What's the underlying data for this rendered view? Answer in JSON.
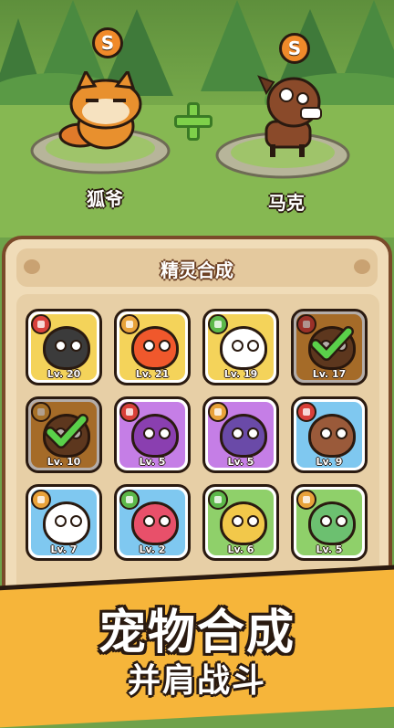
{
  "merge": {
    "left_pet": {
      "name": "狐爷",
      "coin_symbol": "S",
      "icon": "fox-pet-icon"
    },
    "right_pet": {
      "name": "马克",
      "coin_symbol": "S",
      "icon": "horse-pet-icon"
    },
    "plus_icon": "plus-icon"
  },
  "panel": {
    "title": "精灵合成"
  },
  "pets": [
    {
      "level": "Lv. 20",
      "element": "fire",
      "bg": "#f4d35a",
      "body": "#3b3b3b",
      "selected": false
    },
    {
      "level": "Lv. 21",
      "element": "shield",
      "bg": "#f4d35a",
      "body": "#f0582c",
      "selected": false
    },
    {
      "level": "Lv. 19",
      "element": "leaf",
      "bg": "#f4d35a",
      "body": "#ffffff",
      "selected": false
    },
    {
      "level": "Lv. 17",
      "element": "fire",
      "bg": "#e89a3a",
      "body": "#7a4a2a",
      "selected": true
    },
    {
      "level": "Lv. 10",
      "element": "shield",
      "bg": "#e89a3a",
      "body": "#7a4a2a",
      "selected": true
    },
    {
      "level": "Lv. 5",
      "element": "fire",
      "bg": "#c57ee6",
      "body": "#8a3fb0",
      "selected": false
    },
    {
      "level": "Lv. 5",
      "element": "shield",
      "bg": "#c57ee6",
      "body": "#6a4aa8",
      "selected": false
    },
    {
      "level": "Lv. 9",
      "element": "fire",
      "bg": "#7fc8f0",
      "body": "#9a5a3a",
      "selected": false
    },
    {
      "level": "Lv. 7",
      "element": "shield",
      "bg": "#7fc8f0",
      "body": "#ffffff",
      "selected": false
    },
    {
      "level": "Lv. 2",
      "element": "leaf",
      "bg": "#7fc8f0",
      "body": "#e8506a",
      "selected": false
    },
    {
      "level": "Lv. 6",
      "element": "leaf",
      "bg": "#8fd06a",
      "body": "#f2c84a",
      "selected": false
    },
    {
      "level": "Lv. 5",
      "element": "shield",
      "bg": "#8fd06a",
      "body": "#6cc070",
      "selected": false
    }
  ],
  "element_colors": {
    "fire": "#d8403a",
    "shield": "#e8a23a",
    "leaf": "#5cb84a"
  },
  "banner": {
    "line1": "宠物合成",
    "line2": "并肩战斗"
  }
}
